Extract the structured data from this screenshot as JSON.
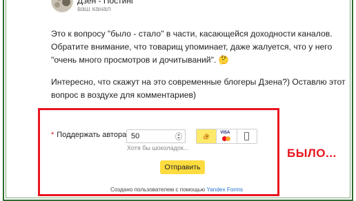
{
  "channel": {
    "name": "Дзен - Постинг",
    "subtitle": "ваш канал"
  },
  "post": {
    "paragraph1": [
      "Это к вопросу \"было - стало\" в части, касающейся доходности каналов.",
      "Обратите внимание, что товарищ упоминает, даже жалуется, что у него",
      "\"очень много просмотров и дочитываний\". 🤔"
    ],
    "paragraph2": [
      "Интересно, что скажут на это современные блогеры Дзена?) Оставлю этот",
      "вопрос в воздухе для комментариев)"
    ]
  },
  "form": {
    "required_mark": "*",
    "label": "Поддержать автора:",
    "amount_value": "50",
    "hint": "Хотя бы шоколадок...",
    "payment_methods": [
      {
        "name": "yandex-money",
        "icon": "yandex-money-icon",
        "selected": true
      },
      {
        "name": "card",
        "label": "VISA",
        "icon": "card-icon",
        "selected": false
      },
      {
        "name": "mobile",
        "icon": "phone-icon",
        "selected": false
      }
    ],
    "submit_label": "Отправить",
    "footer_text": "Создано пользователем с помощью ",
    "footer_link": "Yandex Forms"
  },
  "stamp": "БЫЛО...",
  "colors": {
    "highlight_border": "#e8141d",
    "submit_bg": "#fddc3f",
    "selected_method_bg": "#fde96a",
    "link": "#2472c8",
    "frame_green": "#2f6b2f"
  }
}
